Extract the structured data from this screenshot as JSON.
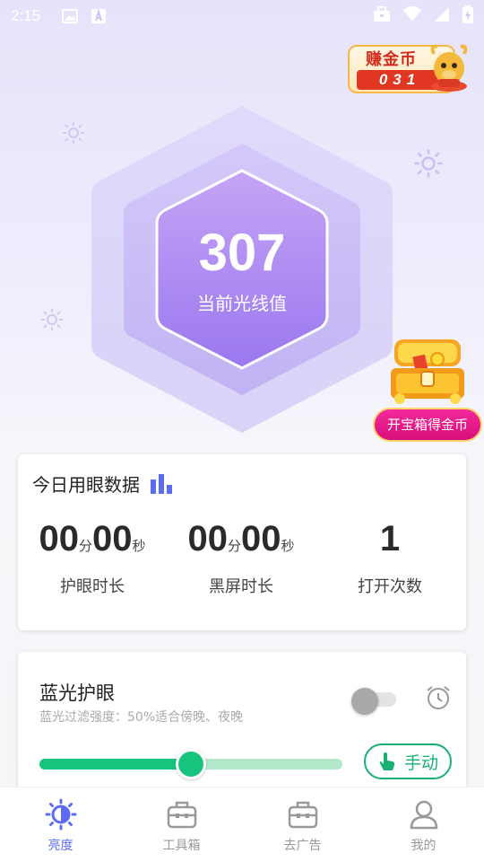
{
  "status_bar": {
    "time": "2:15"
  },
  "coin_widget": {
    "title": "赚金币",
    "count": "031"
  },
  "light_meter": {
    "value": "307",
    "label": "当前光线值"
  },
  "treasure": {
    "button_label": "开宝箱得金币"
  },
  "today": {
    "title": "今日用眼数据",
    "stats": [
      {
        "min": "00",
        "min_unit": "分",
        "sec": "00",
        "sec_unit": "秒",
        "label": "护眼时长"
      },
      {
        "min": "00",
        "min_unit": "分",
        "sec": "00",
        "sec_unit": "秒",
        "label": "黑屏时长"
      },
      {
        "count": "1",
        "label": "打开次数"
      }
    ]
  },
  "blue_light": {
    "title": "蓝光护眼",
    "subtitle": "蓝光过滤强度：50%适合傍晚、夜晚",
    "enabled": false,
    "intensity": 0.5,
    "manual_label": "手动"
  },
  "colors": {
    "accent": "#5b6cf0",
    "green": "#16c47d",
    "hex_purple": "#a07cf0"
  },
  "bottom_nav": [
    {
      "label": "亮度",
      "icon": "brightness-icon",
      "active": true
    },
    {
      "label": "工具箱",
      "icon": "toolbox-icon",
      "active": false
    },
    {
      "label": "去广告",
      "icon": "remove-ads-icon",
      "active": false
    },
    {
      "label": "我的",
      "icon": "profile-icon",
      "active": false
    }
  ]
}
